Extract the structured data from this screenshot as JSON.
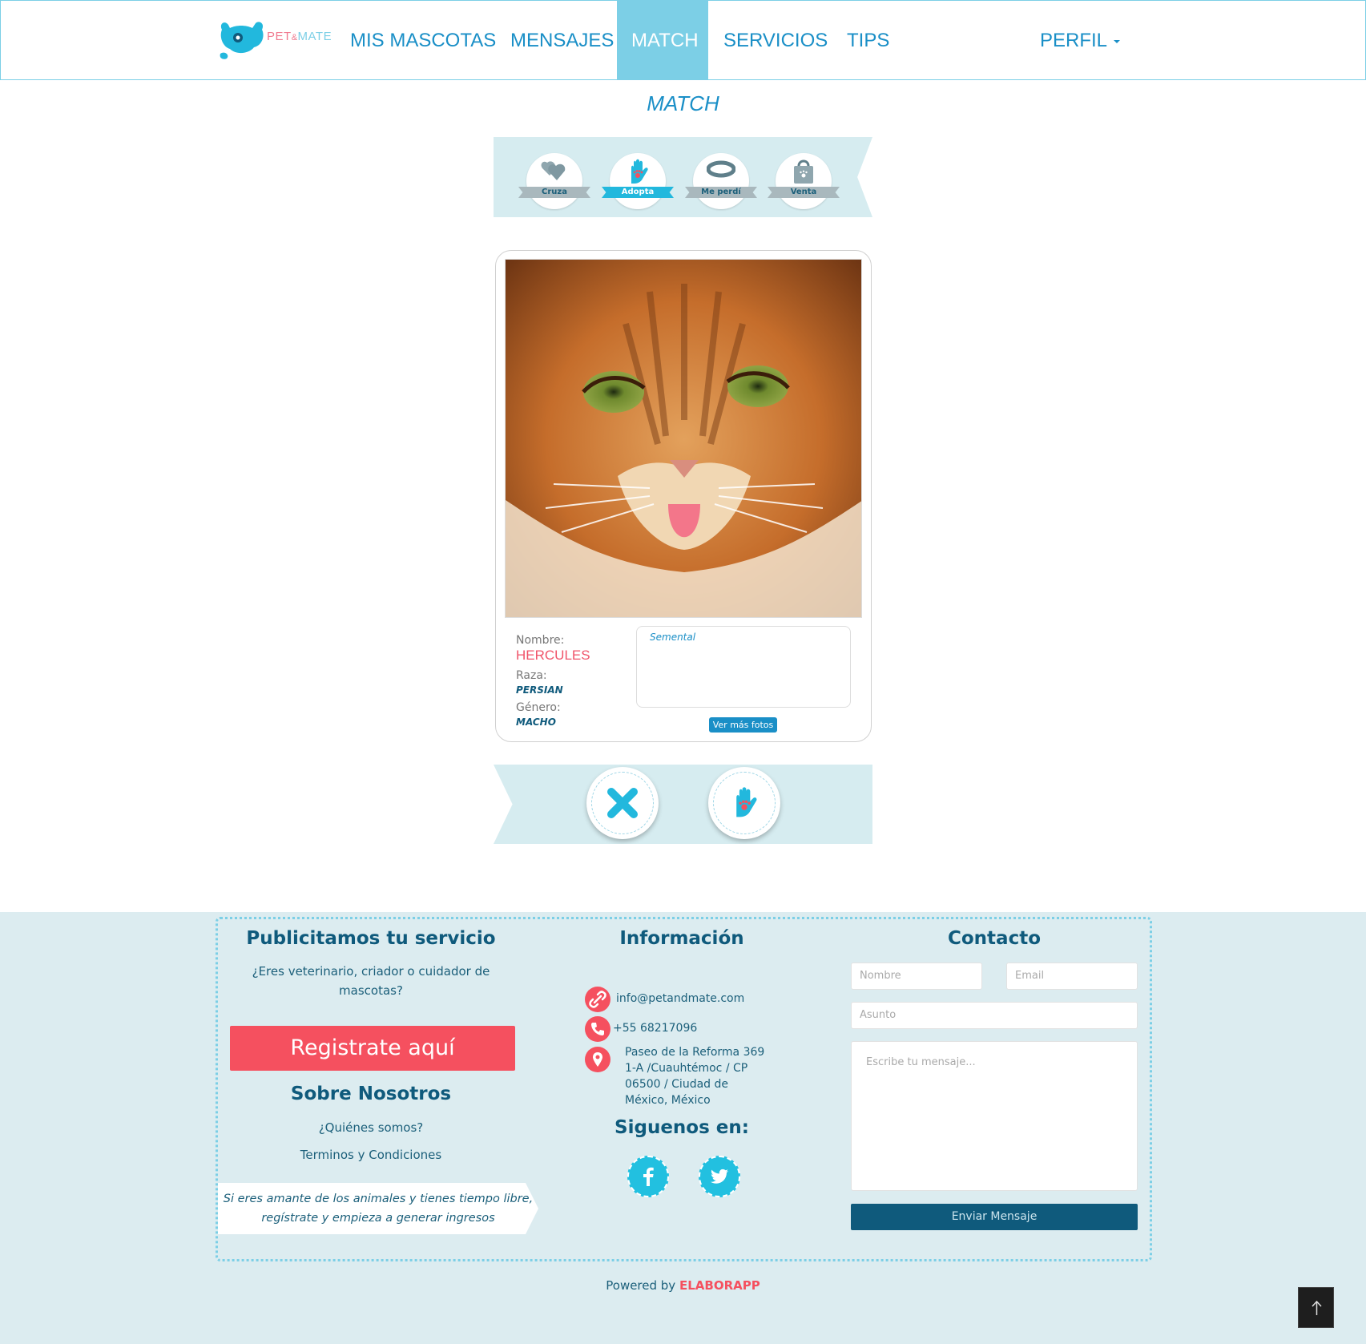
{
  "app": {
    "logo_text_1": "PET",
    "logo_text_amp": "&",
    "logo_text_2": "MATE"
  },
  "nav": {
    "items": [
      {
        "label": "MIS MASCOTAS"
      },
      {
        "label": "MENSAJES"
      },
      {
        "label": "MATCH",
        "active": true
      },
      {
        "label": "SERVICIOS"
      },
      {
        "label": "TIPS"
      }
    ],
    "profile_label": "PERFIL"
  },
  "page": {
    "title": "MATCH"
  },
  "categories": [
    {
      "label": "Cruza",
      "icon": "hearts-icon"
    },
    {
      "label": "Adopta",
      "icon": "hand-paw-icon",
      "active": true
    },
    {
      "label": "Me perdí",
      "icon": "collar-icon"
    },
    {
      "label": "Venta",
      "icon": "shopping-bag-icon"
    }
  ],
  "pet": {
    "name_label": "Nombre:",
    "name": "HERCULES",
    "breed_label": "Raza:",
    "breed": "PERSIAN",
    "gender_label": "Género:",
    "gender": "MACHO",
    "description": "Semental",
    "more_photos_label": "Ver más fotos"
  },
  "actions": {
    "reject_icon": "x-icon",
    "accept_icon": "hand-paw-icon"
  },
  "footer": {
    "services": {
      "title": "Publicitamos tu servicio",
      "text": "¿Eres veterinario, criador o cuidador de mascotas?",
      "register_label": "Registrate aquí"
    },
    "about": {
      "title": "Sobre Nosotros",
      "links": [
        "¿Quiénes somos?",
        "Terminos y Condiciones"
      ]
    },
    "promo": "Si eres amante de los animales y tienes tiempo libre, regístrate y empieza a generar ingresos",
    "info": {
      "title": "Información",
      "email": "info@petandmate.com",
      "phone": "+55 68217096",
      "address": "Paseo de la Reforma 369 1-A /Cuauhtémoc / CP 06500 / Ciudad de México, México"
    },
    "social": {
      "title": "Siguenos en:",
      "networks": [
        "facebook-icon",
        "twitter-icon"
      ]
    },
    "contact": {
      "title": "Contacto",
      "name_placeholder": "Nombre",
      "email_placeholder": "Email",
      "subject_placeholder": "Asunto",
      "message_placeholder": "Escribe tu mensaje...",
      "send_label": "Enviar Mensaje"
    },
    "powered_prefix": "Powered by",
    "powered_brand": "ELABORAPP"
  },
  "colors": {
    "primary": "#1a8fc7",
    "accent": "#7ccfe6",
    "coral": "#f5505f",
    "navy": "#0f5a7c",
    "footer_bg": "#dcecf0"
  }
}
